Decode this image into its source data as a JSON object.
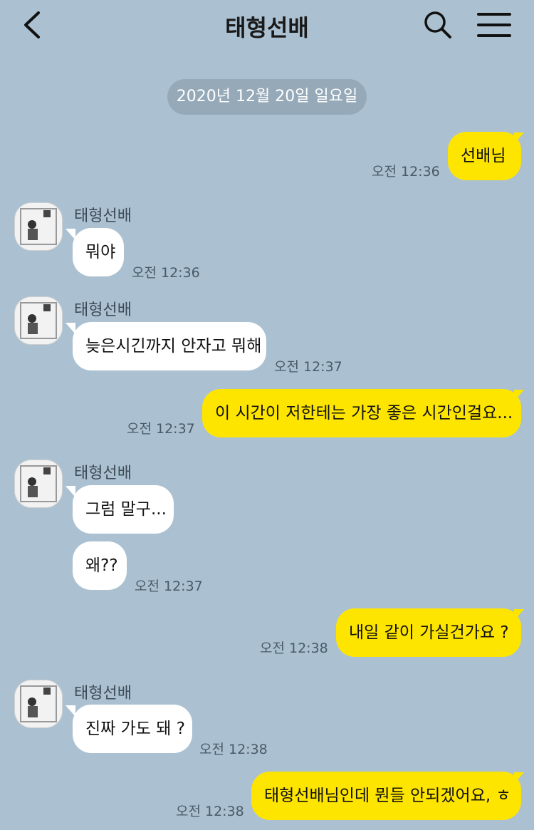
{
  "header": {
    "title": "태형선배",
    "back_icon": "chevron-left-icon",
    "search_icon": "search-icon",
    "menu_icon": "hamburger-menu-icon"
  },
  "date_divider": "2020년 12월 20일 일요일",
  "colors": {
    "background": "#abc1d1",
    "my_bubble": "#fee500",
    "their_bubble": "#ffffff",
    "date_pill": "#95a9b8"
  },
  "messages": [
    {
      "from": "me",
      "text": "선배님",
      "time": "오전 12:36"
    },
    {
      "from": "them",
      "sender": "태형선배",
      "text": "뭐야",
      "time": "오전 12:36"
    },
    {
      "from": "them",
      "sender": "태형선배",
      "text": "늦은시긴까지 안자고 뭐해",
      "time": "오전 12:37"
    },
    {
      "from": "me",
      "text": "이 시간이 저한테는 가장 좋은 시간인걸요...",
      "time": "오전 12:37"
    },
    {
      "from": "them",
      "sender": "태형선배",
      "text": "그럼 말구...",
      "time": ""
    },
    {
      "from": "them",
      "text": "왜??",
      "time": "오전 12:37"
    },
    {
      "from": "me",
      "text": "내일 같이 가실건가요 ?",
      "time": "오전 12:38"
    },
    {
      "from": "them",
      "sender": "태형선배",
      "text": "진짜 가도 돼 ?",
      "time": "오전 12:38"
    },
    {
      "from": "me",
      "text": "태형선배님인데 뭔들 안되겠어요, ㅎ",
      "time": "오전 12:38"
    }
  ]
}
